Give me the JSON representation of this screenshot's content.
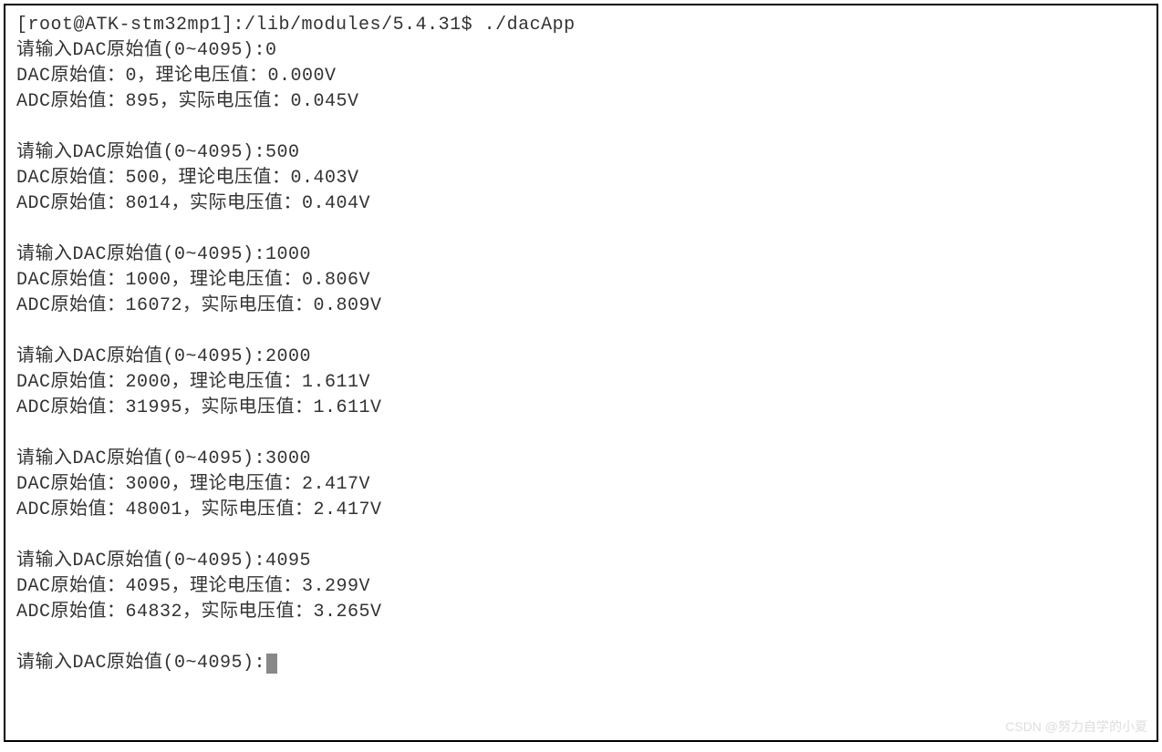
{
  "prompt_line": "[root@ATK-stm32mp1]:/lib/modules/5.4.31$ ./dacApp",
  "blocks": [
    {
      "input_line": "请输入DAC原始值(0~4095):0",
      "dac_line": "DAC原始值：0，理论电压值：0.000V",
      "adc_line": "ADC原始值：895，实际电压值：0.045V"
    },
    {
      "input_line": "请输入DAC原始值(0~4095):500",
      "dac_line": "DAC原始值：500，理论电压值：0.403V",
      "adc_line": "ADC原始值：8014，实际电压值：0.404V"
    },
    {
      "input_line": "请输入DAC原始值(0~4095):1000",
      "dac_line": "DAC原始值：1000，理论电压值：0.806V",
      "adc_line": "ADC原始值：16072，实际电压值：0.809V"
    },
    {
      "input_line": "请输入DAC原始值(0~4095):2000",
      "dac_line": "DAC原始值：2000，理论电压值：1.611V",
      "adc_line": "ADC原始值：31995，实际电压值：1.611V"
    },
    {
      "input_line": "请输入DAC原始值(0~4095):3000",
      "dac_line": "DAC原始值：3000，理论电压值：2.417V",
      "adc_line": "ADC原始值：48001，实际电压值：2.417V"
    },
    {
      "input_line": "请输入DAC原始值(0~4095):4095",
      "dac_line": "DAC原始值：4095，理论电压值：3.299V",
      "adc_line": "ADC原始值：64832，实际电压值：3.265V"
    }
  ],
  "final_prompt": "请输入DAC原始值(0~4095):",
  "watermark": "CSDN @努力自学的小夏"
}
